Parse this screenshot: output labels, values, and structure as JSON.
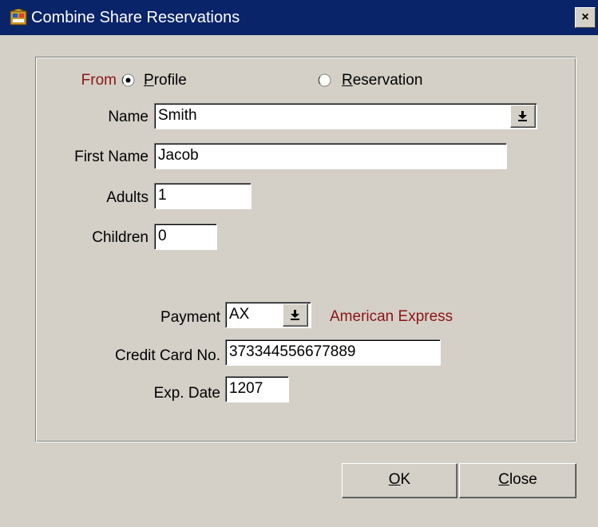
{
  "window": {
    "title": "Combine Share Reservations",
    "title_icon": "app-icon",
    "close_glyph": "×",
    "titlebar_color": "#0a246a"
  },
  "from": {
    "label": "From",
    "options": [
      {
        "prefix": "",
        "mnemonic": "P",
        "rest": "rofile",
        "selected": true
      },
      {
        "prefix": "",
        "mnemonic": "R",
        "rest": "eservation",
        "selected": false
      }
    ]
  },
  "fields": {
    "name": {
      "label": "Name",
      "value": "Smith"
    },
    "first_name": {
      "label": "First Name",
      "value": "Jacob"
    },
    "adults": {
      "label": "Adults",
      "value": "1"
    },
    "children": {
      "label": "Children",
      "value": "0"
    },
    "payment": {
      "label": "Payment",
      "value": "AX",
      "description": "American Express"
    },
    "credit_card": {
      "label": "Credit Card No.",
      "value": "373344556677889"
    },
    "exp_date": {
      "label": "Exp. Date",
      "value": "1207"
    }
  },
  "buttons": {
    "ok": {
      "mnemonic": "O",
      "rest": "K"
    },
    "close": {
      "mnemonic": "C",
      "rest": "lose"
    }
  },
  "colors": {
    "label_accent": "#8b1414",
    "dialog_bg": "#d4d0c8"
  }
}
